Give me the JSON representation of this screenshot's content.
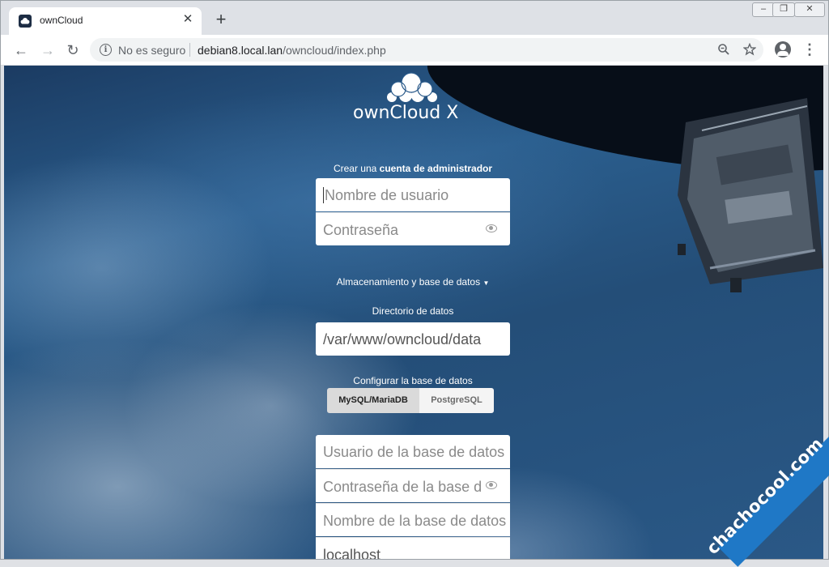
{
  "browser": {
    "tab": {
      "title": "ownCloud",
      "close": "✕"
    },
    "new_tab": "+",
    "window_controls": {
      "minimize": "‒",
      "restore": "❐",
      "close": "✕"
    },
    "nav": {
      "back": "←",
      "forward": "→",
      "reload": "↻"
    },
    "omnibox": {
      "security_label": "No es seguro",
      "url_host": "debian8.local.lan",
      "url_path": "/owncloud/index.php"
    },
    "icons": {
      "zoom": "zoom-icon",
      "star": "star-icon",
      "profile": "profile-icon",
      "menu": "⋮"
    }
  },
  "page": {
    "logo_text": "ownCloud X",
    "admin_heading_prefix": "Crear una",
    "admin_heading_bold": "cuenta de administrador",
    "username_placeholder": "Nombre de usuario",
    "password_placeholder": "Contraseña",
    "storage_toggle": "Almacenamiento y base de datos",
    "data_dir_label": "Directorio de datos",
    "data_dir_value": "/var/www/owncloud/data",
    "db_config_label": "Configurar la base de datos",
    "db_options": [
      "MySQL/MariaDB",
      "PostgreSQL"
    ],
    "db_selected": "MySQL/MariaDB",
    "db_user_placeholder": "Usuario de la base de datos",
    "db_password_placeholder": "Contraseña de la base de datos",
    "db_name_placeholder": "Nombre de la base de datos",
    "db_host_value": "localhost"
  },
  "watermark": "chachocool.com"
}
